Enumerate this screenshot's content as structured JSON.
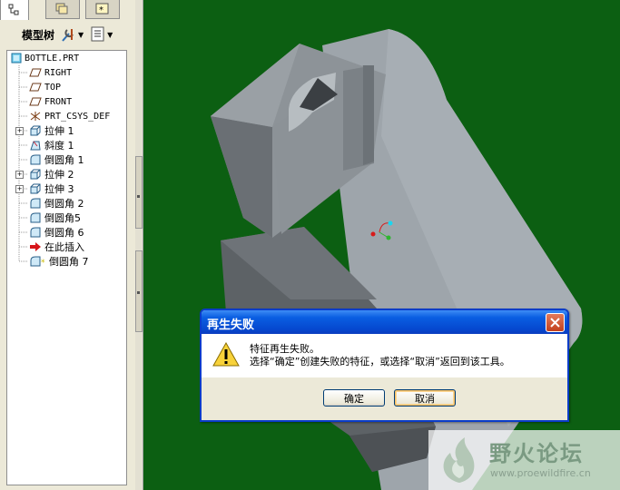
{
  "left_panel": {
    "tabs": [
      {
        "icon": "tree-icon"
      },
      {
        "icon": "layers-icon"
      },
      {
        "icon": "favorites-icon"
      }
    ],
    "toolbar": {
      "model_tree_label": "模型树",
      "settings_icon": "tools-icon",
      "show_icon": "list-icon"
    },
    "tree": {
      "items": [
        {
          "label": "BOTTLE.PRT",
          "icon": "part-icon"
        },
        {
          "label": "RIGHT",
          "icon": "datum-plane-icon"
        },
        {
          "label": "TOP",
          "icon": "datum-plane-icon"
        },
        {
          "label": "FRONT",
          "icon": "datum-plane-icon"
        },
        {
          "label": "PRT_CSYS_DEF",
          "icon": "csys-icon"
        },
        {
          "label": "拉伸 1",
          "icon": "extrude-icon"
        },
        {
          "label": "斜度 1",
          "icon": "draft-icon"
        },
        {
          "label": "倒圆角 1",
          "icon": "round-icon"
        },
        {
          "label": "拉伸 2",
          "icon": "extrude-icon"
        },
        {
          "label": "拉伸 3",
          "icon": "extrude-icon"
        },
        {
          "label": "倒圆角 2",
          "icon": "round-icon"
        },
        {
          "label": "倒圆角5",
          "icon": "round-icon"
        },
        {
          "label": "倒圆角 6",
          "icon": "round-icon"
        },
        {
          "label": "在此插入",
          "icon": "insert-arrow-icon"
        },
        {
          "label": "倒圆角 7",
          "icon": "failed-round-icon"
        }
      ]
    }
  },
  "dialog": {
    "title": "再生失败",
    "message_line1": "特征再生失败。",
    "message_line2": "选择“确定”创建失败的特征，或选择“取消”返回到该工具。",
    "ok_label": "确定",
    "cancel_label": "取消"
  },
  "watermark": {
    "name": "野火论坛",
    "url": "www.proewildfire.cn"
  },
  "colors": {
    "viewport_background": "#0c5f12",
    "dialog_title_blue": "#0548cf",
    "model_gray": "#9aa1a7"
  }
}
